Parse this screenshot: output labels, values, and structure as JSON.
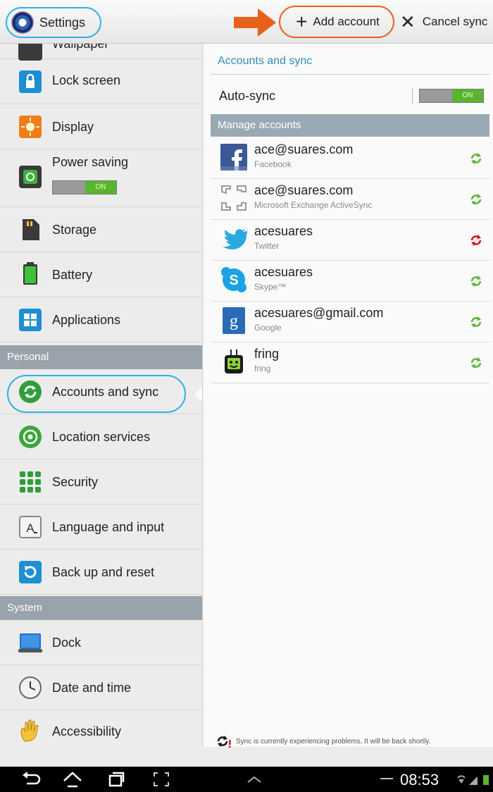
{
  "actionbar": {
    "app_title": "Settings",
    "add_account": "Add account",
    "cancel_sync": "Cancel sync"
  },
  "sidebar": {
    "items": [
      {
        "label": "Wallpaper",
        "icon": "wallpaper-icon"
      },
      {
        "label": "Lock screen",
        "icon": "lock-icon"
      },
      {
        "label": "Display",
        "icon": "display-icon"
      },
      {
        "label": "Power saving",
        "icon": "power-saving-icon",
        "toggle": "ON"
      },
      {
        "label": "Storage",
        "icon": "storage-icon"
      },
      {
        "label": "Battery",
        "icon": "battery-icon"
      },
      {
        "label": "Applications",
        "icon": "applications-icon"
      }
    ],
    "personal_header": "Personal",
    "personal_items": [
      {
        "label": "Accounts and sync",
        "icon": "sync-icon",
        "selected": true
      },
      {
        "label": "Location services",
        "icon": "location-icon"
      },
      {
        "label": "Security",
        "icon": "security-icon"
      },
      {
        "label": "Language and input",
        "icon": "language-icon"
      },
      {
        "label": "Back up and reset",
        "icon": "backup-icon"
      }
    ],
    "system_header": "System",
    "system_items": [
      {
        "label": "Dock",
        "icon": "dock-icon"
      },
      {
        "label": "Date and time",
        "icon": "clock-icon"
      },
      {
        "label": "Accessibility",
        "icon": "accessibility-icon"
      }
    ]
  },
  "main": {
    "title": "Accounts and sync",
    "autosync_label": "Auto-sync",
    "autosync_toggle": "ON",
    "manage_header": "Manage accounts",
    "accounts": [
      {
        "name": "ace@suares.com",
        "type": "Facebook",
        "icon": "facebook-icon",
        "sync_status": "ok"
      },
      {
        "name": "ace@suares.com",
        "type": "Microsoft Exchange ActiveSync",
        "icon": "exchange-icon",
        "sync_status": "ok"
      },
      {
        "name": "acesuares",
        "type": "Twitter",
        "icon": "twitter-icon",
        "sync_status": "error"
      },
      {
        "name": "acesuares",
        "type": "Skype™",
        "icon": "skype-icon",
        "sync_status": "ok"
      },
      {
        "name": "acesuares@gmail.com",
        "type": "Google",
        "icon": "google-icon",
        "sync_status": "ok"
      },
      {
        "name": "fring",
        "type": "fring",
        "icon": "fring-icon",
        "sync_status": "ok"
      }
    ],
    "sync_message": "Sync is currently experiencing problems. It will be back shortly."
  },
  "navbar": {
    "time": "08:53"
  },
  "colors": {
    "accent_blue": "#2fb0e2",
    "highlight_orange": "#e8611b",
    "sync_ok": "#5ab52e",
    "sync_error": "#d4121a"
  }
}
